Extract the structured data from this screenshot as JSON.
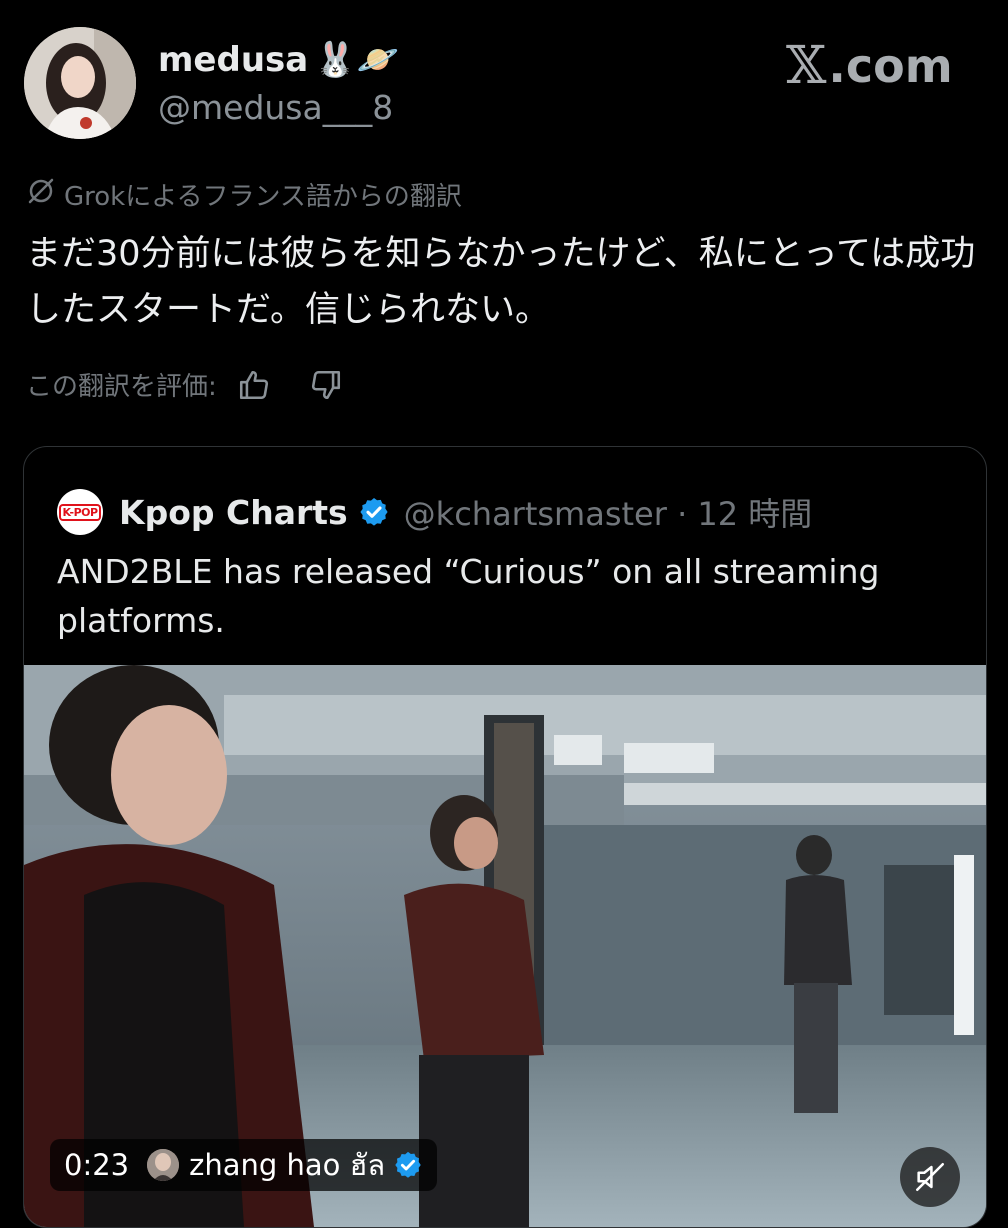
{
  "author": {
    "display_name": "medusa",
    "emojis": "🐰🪐",
    "handle": "@medusa___8"
  },
  "watermark": {
    "x_glyph": "𝕏",
    "text": ".com"
  },
  "translation": {
    "note": "Grokによるフランス語からの翻訳",
    "text": "まだ30分前には彼らを知らなかったけど、私にとっては成功したスタートだ。信じられない。",
    "rate_label": "この翻訳を評価:"
  },
  "quote": {
    "logo_text": "K-POP",
    "name": "Kpop Charts",
    "handle_time": "@kchartsmaster · 12 時間",
    "text": "AND2BLE has released “Curious” on all streaming platforms."
  },
  "video": {
    "time": "0:23",
    "author": "zhang hao ฮัล",
    "muted": true
  },
  "colors": {
    "background": "#000000",
    "muted_text": "#71767b",
    "verified": "#1d9bf0",
    "kpop_red": "#e0121b"
  },
  "icons": [
    "grok-icon",
    "thumbs-up-icon",
    "thumbs-down-icon",
    "verified-badge-icon",
    "mute-icon"
  ]
}
